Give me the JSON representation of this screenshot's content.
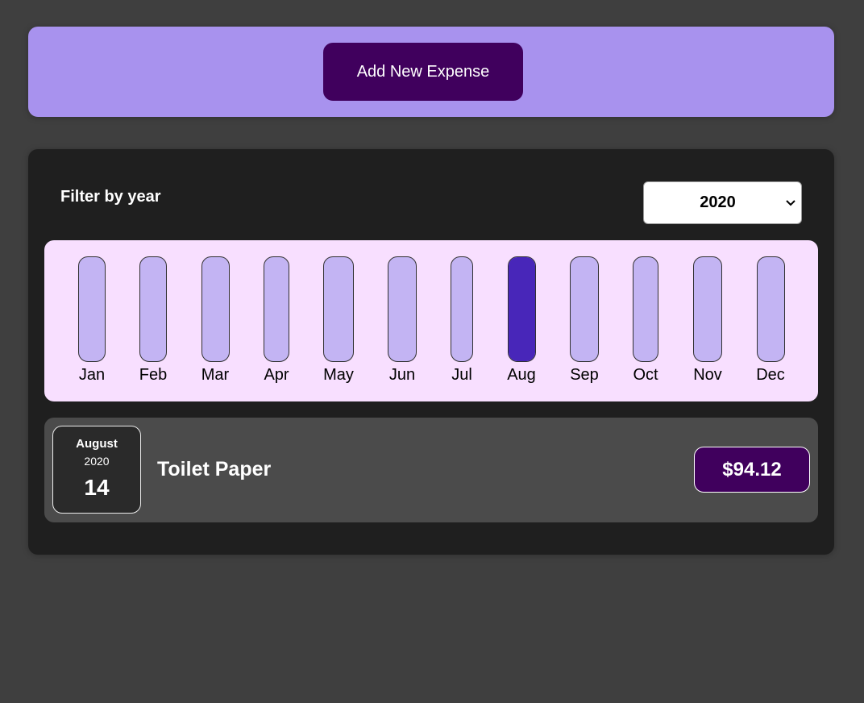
{
  "new_expense": {
    "add_button_label": "Add New Expense"
  },
  "filter": {
    "label": "Filter by year",
    "selected_year": "2020"
  },
  "chart_data": {
    "type": "bar",
    "categories": [
      "Jan",
      "Feb",
      "Mar",
      "Apr",
      "May",
      "Jun",
      "Jul",
      "Aug",
      "Sep",
      "Oct",
      "Nov",
      "Dec"
    ],
    "values": [
      0,
      0,
      0,
      0,
      0,
      0,
      0,
      94.12,
      0,
      0,
      0,
      0
    ],
    "max_value": 94.12,
    "colors": {
      "track": "#c3b4f3",
      "fill": "#4826b9",
      "background": "#f8dfff"
    }
  },
  "expenses": [
    {
      "month": "August",
      "year": "2020",
      "day": "14",
      "title": "Toilet Paper",
      "amount": "$94.12"
    }
  ]
}
